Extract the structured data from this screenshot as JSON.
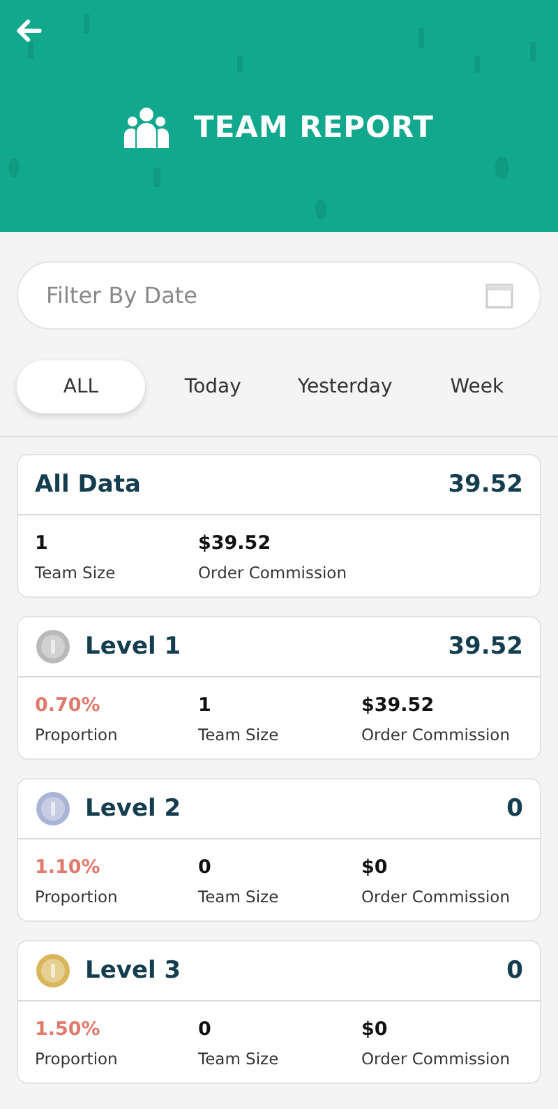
{
  "header": {
    "title": "TEAM REPORT"
  },
  "filter": {
    "placeholder": "Filter By Date"
  },
  "tabs": [
    {
      "label": "ALL",
      "selected": true
    },
    {
      "label": "Today",
      "selected": false
    },
    {
      "label": "Yesterday",
      "selected": false
    },
    {
      "label": "Week",
      "selected": false
    }
  ],
  "summary": {
    "title": "All Data",
    "total": "39.52",
    "stats": [
      {
        "value": "1",
        "label": "Team Size"
      },
      {
        "value": "$39.52",
        "label": "Order Commission"
      }
    ]
  },
  "levels": [
    {
      "title": "Level 1",
      "total": "39.52",
      "color": "#b9b9b9",
      "proportion": {
        "value": "0.70%",
        "label": "Proportion"
      },
      "stats": [
        {
          "value": "1",
          "label": "Team Size"
        },
        {
          "value": "$39.52",
          "label": "Order Commission"
        }
      ]
    },
    {
      "title": "Level 2",
      "total": "0",
      "color": "#a9b4d6",
      "proportion": {
        "value": "1.10%",
        "label": "Proportion"
      },
      "stats": [
        {
          "value": "0",
          "label": "Team Size"
        },
        {
          "value": "$0",
          "label": "Order Commission"
        }
      ]
    },
    {
      "title": "Level 3",
      "total": "0",
      "color": "#d9b65a",
      "proportion": {
        "value": "1.50%",
        "label": "Proportion"
      },
      "stats": [
        {
          "value": "0",
          "label": "Team Size"
        },
        {
          "value": "$0",
          "label": "Order Commission"
        }
      ]
    }
  ]
}
